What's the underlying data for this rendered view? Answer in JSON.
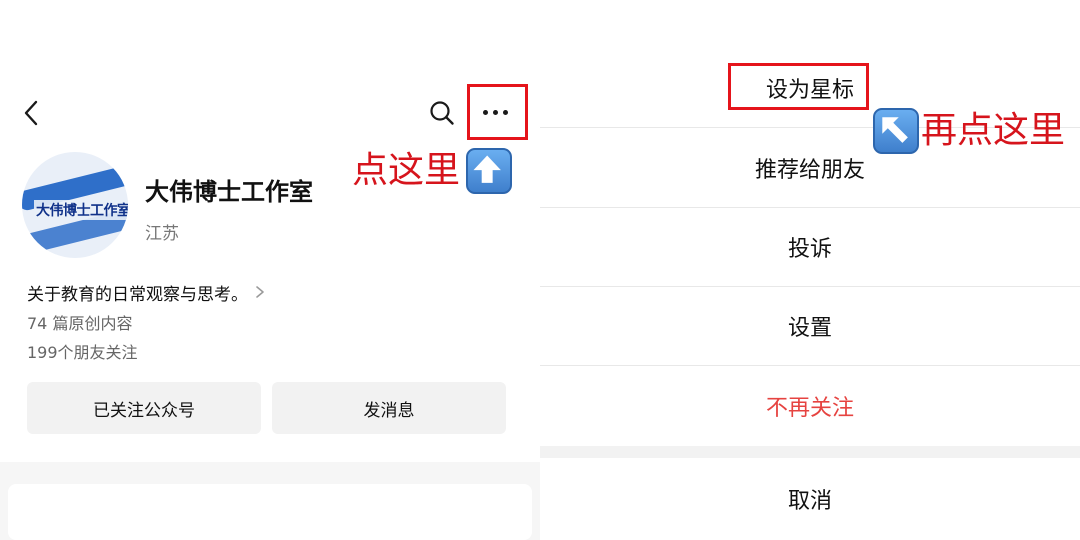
{
  "profile": {
    "name": "大伟博士工作室",
    "region": "江苏",
    "avatar_text": "大伟博士工作室",
    "intro": "关于教育的日常观察与思考。",
    "stats": {
      "original_count": "74 篇原创内容",
      "friends_following": "199个朋友关注"
    }
  },
  "actions": {
    "follow_label": "已关注公众号",
    "message_label": "发消息"
  },
  "annotations": {
    "left_hint": "点这里",
    "right_hint": "再点这里"
  },
  "sheet": {
    "items": [
      {
        "label": "设为星标"
      },
      {
        "label": "推荐给朋友"
      },
      {
        "label": "投诉"
      },
      {
        "label": "设置"
      },
      {
        "label": "不再关注"
      }
    ],
    "cancel_label": "取消"
  },
  "colors": {
    "annotation_red": "#e5141b",
    "danger_red": "#e64340",
    "arrow_badge_blue": "#4a8ad8"
  },
  "icons": {
    "back": "chevron-left-icon",
    "search": "search-icon",
    "more": "more-dots-icon",
    "intro_arrow": "chevron-right-icon",
    "up_arrow": "arrow-up-icon",
    "up_left_arrow": "arrow-up-left-icon"
  }
}
